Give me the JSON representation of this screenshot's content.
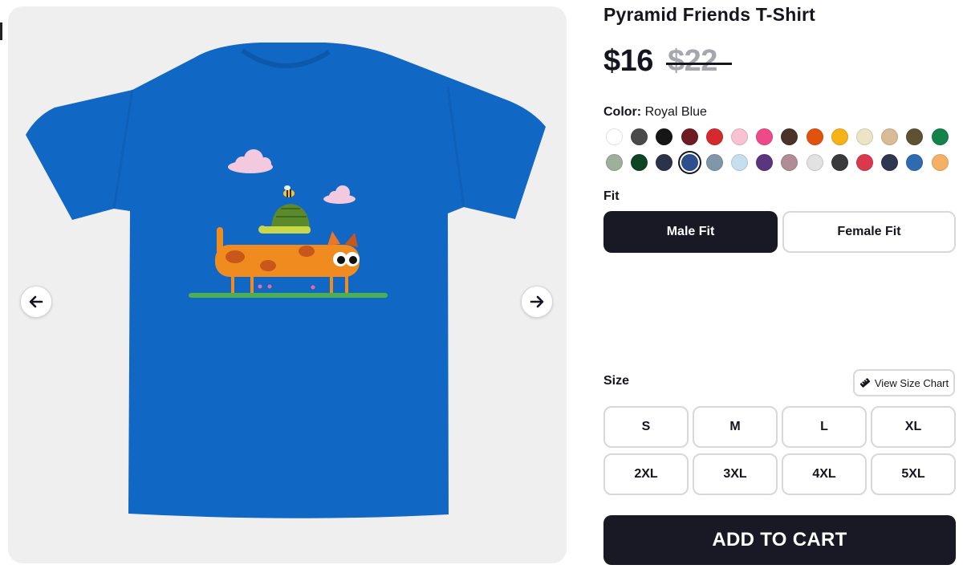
{
  "product": {
    "title": "Pyramid Friends T-Shirt",
    "price_current": "$16",
    "price_original": "$22"
  },
  "gallery": {
    "prev_icon": "arrow-left-icon",
    "next_icon": "arrow-right-icon"
  },
  "color": {
    "label": "Color:",
    "selected_name": "Royal Blue",
    "swatches": [
      "#ffffff",
      "#4a4a4a",
      "#161616",
      "#6e1a22",
      "#d42a2e",
      "#f8c2d2",
      "#ee4a8a",
      "#4a3328",
      "#e2520f",
      "#f6b318",
      "#ede3c6",
      "#d9bc96",
      "#5e5233",
      "#14834a",
      "#9cb09a",
      "#0e4524",
      "#2a3348",
      "#2e4f8e",
      "#7f97a8",
      "#c7deec",
      "#5a367e",
      "#b08c95",
      "#e2e2e2",
      "#3a3a3c",
      "#d9394c",
      "#2e3650",
      "#2f6bb1",
      "#f5b066"
    ],
    "selected_index": 17
  },
  "fit": {
    "label": "Fit",
    "options": [
      "Male Fit",
      "Female Fit"
    ],
    "selected": "Male Fit"
  },
  "size": {
    "label": "Size",
    "chart_button": "View Size Chart",
    "chart_icon": "ruler-icon",
    "options": [
      "S",
      "M",
      "L",
      "XL",
      "2XL",
      "3XL",
      "4XL",
      "5XL"
    ]
  },
  "cart": {
    "button": "ADD TO CART"
  }
}
